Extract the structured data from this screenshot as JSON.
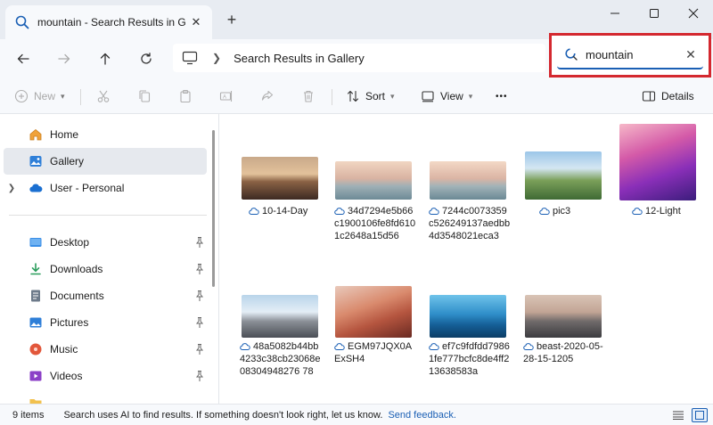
{
  "window": {
    "tab_title": "mountain - Search Results in G",
    "new_tab": "+"
  },
  "address": {
    "breadcrumb": "Search Results in Gallery"
  },
  "search": {
    "value": "mountain"
  },
  "commands": {
    "new": "New",
    "sort": "Sort",
    "view": "View",
    "more": "•••",
    "details": "Details"
  },
  "sidebar": {
    "items": [
      {
        "label": "Home",
        "icon": "home-icon"
      },
      {
        "label": "Gallery",
        "icon": "gallery-icon",
        "selected": true
      },
      {
        "label": "User - Personal",
        "icon": "onedrive-cloud-icon",
        "expandable": true
      }
    ],
    "pinned": [
      {
        "label": "Desktop",
        "icon": "desktop-folder-icon"
      },
      {
        "label": "Downloads",
        "icon": "downloads-icon"
      },
      {
        "label": "Documents",
        "icon": "documents-icon"
      },
      {
        "label": "Pictures",
        "icon": "pictures-icon"
      },
      {
        "label": "Music",
        "icon": "music-icon"
      },
      {
        "label": "Videos",
        "icon": "videos-icon"
      }
    ]
  },
  "files": [
    {
      "name": "10-14-Day"
    },
    {
      "name": "34d7294e5b66c1900106fe8fd6101c2648a15d56"
    },
    {
      "name": "7244c0073359c526249137aedbb4d3548021eca3"
    },
    {
      "name": "pic3"
    },
    {
      "name": "12-Light"
    },
    {
      "name": "48a5082b44bb4233c38cb23068e08304948276 78"
    },
    {
      "name": "EGM97JQX0AExSH4"
    },
    {
      "name": "ef7c9fdfdd79861fe777bcfc8de4ff213638583a"
    },
    {
      "name": "beast-2020-05-28-15-1205"
    }
  ],
  "status": {
    "count": "9 items",
    "message": "Search uses AI to find results. If something doesn't look right, let us know.",
    "feedback": "Send feedback."
  },
  "colors": {
    "accent": "#1a5fb4",
    "highlight_border": "#d4282f"
  }
}
